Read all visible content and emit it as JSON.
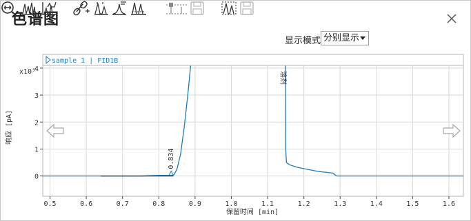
{
  "window": {
    "title": "色谱图"
  },
  "toolbar": {
    "icons": [
      "zoom-fit-icon",
      "peaks-overlay-icon",
      "peaks-stack-icon",
      "link-icon",
      "peak-label-icon",
      "integrate-icon",
      "baseline-icon",
      "marker-disabled-icon",
      "save-disabled-icon",
      "peak-range-icon",
      "save2-disabled-icon"
    ]
  },
  "display_mode": {
    "label": "显示模式",
    "value": "分别显示"
  },
  "colors": {
    "accent": "#1a7bc0",
    "trace": "#1a7bc0",
    "grid": "#d8d8d8",
    "axis": "#444444"
  },
  "chart_data": {
    "type": "line",
    "legend": "sample 1 | FID1B",
    "xlabel": "保留时间 [min]",
    "ylabel": "响应 [pA]",
    "y_multiplier": "x10⁵",
    "xlim": [
      0.48,
      1.64
    ],
    "ylim": [
      -0.75,
      4.1
    ],
    "xticks": [
      "0.5",
      "0.6",
      "0.7",
      "0.8",
      "0.9",
      "1.0",
      "1.1",
      "1.2",
      "1.3",
      "1.4",
      "1.5",
      "1.6"
    ],
    "yticks": [
      "0",
      "1",
      "2",
      "3",
      "4"
    ],
    "grid": true,
    "annotations": [
      {
        "text": "0.834",
        "x": 0.834,
        "y": 0.0
      },
      {
        "text": "溶剂",
        "x": 1.145,
        "y": 4.1
      }
    ],
    "series": [
      {
        "x": [
          0.48,
          0.6,
          0.65,
          0.7,
          0.75,
          0.78,
          0.8,
          0.82,
          0.834,
          0.842,
          0.85,
          0.86,
          0.87,
          0.88,
          0.89,
          0.9,
          1.149,
          1.15,
          1.152,
          1.16,
          1.18,
          1.2,
          1.22,
          1.24,
          1.25,
          1.26,
          1.27,
          1.28,
          1.29,
          1.3,
          1.4,
          1.5,
          1.64
        ],
        "y": [
          0.0,
          0.0,
          0.0,
          0.0,
          0.0,
          0.01,
          0.02,
          0.02,
          0.02,
          0.05,
          0.25,
          0.8,
          1.8,
          3.0,
          4.4,
          4.4,
          4.4,
          1.0,
          0.5,
          0.42,
          0.33,
          0.27,
          0.22,
          0.17,
          0.15,
          0.14,
          0.12,
          0.11,
          0.0,
          0.0,
          0.0,
          0.0,
          0.0
        ]
      }
    ]
  }
}
